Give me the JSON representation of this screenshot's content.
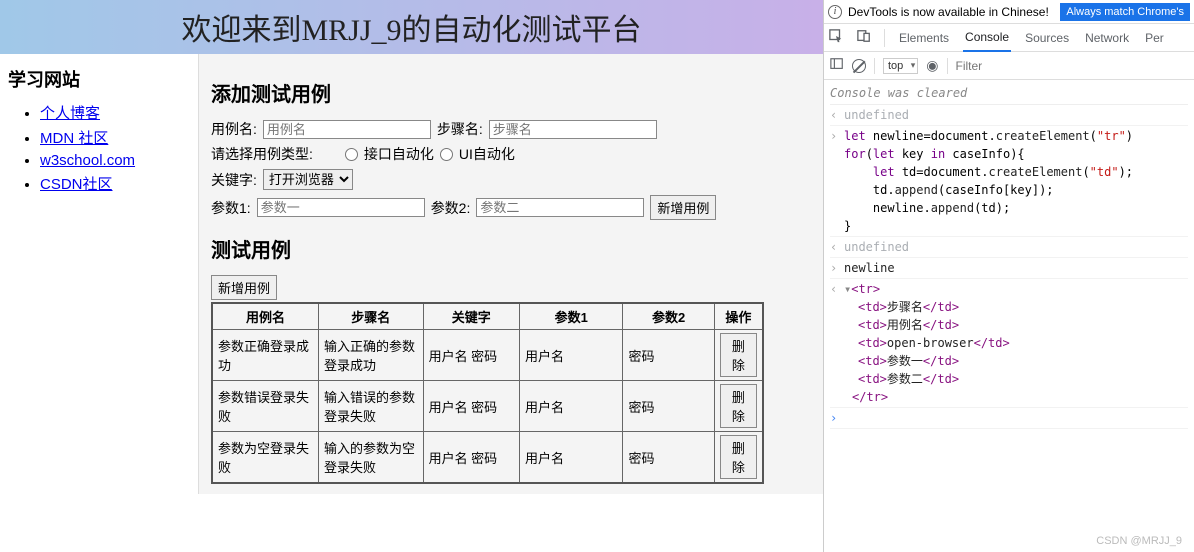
{
  "header": {
    "title": "欢迎来到MRJJ_9的自动化测试平台"
  },
  "sidebar": {
    "heading": "学习网站",
    "links": [
      {
        "label": "个人博客"
      },
      {
        "label": "MDN 社区"
      },
      {
        "label": "w3school.com"
      },
      {
        "label": "CSDN社区"
      }
    ]
  },
  "form": {
    "section_title": "添加测试用例",
    "case_label": "用例名:",
    "case_placeholder": "用例名",
    "step_label": "步骤名:",
    "step_placeholder": "步骤名",
    "type_label": "请选择用例类型:",
    "type_options": [
      "接口自动化",
      "UI自动化"
    ],
    "keyword_label": "关键字:",
    "keyword_selected": "打开浏览器",
    "param1_label": "参数1:",
    "param1_placeholder": "参数一",
    "param2_label": "参数2:",
    "param2_placeholder": "参数二",
    "add_btn": "新增用例"
  },
  "table": {
    "section_title": "测试用例",
    "add_btn": "新增用例",
    "headers": [
      "用例名",
      "步骤名",
      "关键字",
      "参数1",
      "参数2",
      "操作"
    ],
    "delete_label": "删除",
    "rows": [
      {
        "name": "参数正确登录成功",
        "step": "输入正确的参数登录成功",
        "kw": "用户名 密码",
        "p1": "用户名",
        "p2": "密码"
      },
      {
        "name": "参数错误登录失败",
        "step": "输入错误的参数登录失败",
        "kw": "用户名 密码",
        "p1": "用户名",
        "p2": "密码"
      },
      {
        "name": "参数为空登录失败",
        "step": "输入的参数为空登录失败",
        "kw": "用户名 密码",
        "p1": "用户名",
        "p2": "密码"
      }
    ]
  },
  "devtools": {
    "banner_text": "DevTools is now available in Chinese!",
    "banner_btn": "Always match Chrome's",
    "tabs": [
      "Elements",
      "Console",
      "Sources",
      "Network",
      "Per"
    ],
    "active_tab": "Console",
    "context": "top",
    "filter_placeholder": "Filter",
    "cleared_msg": "Console was cleared",
    "undefined_label": "undefined",
    "code_input": "let newline=document.createElement(\"tr\")\nfor(let key in caseInfo){\n    let td=document.createElement(\"td\");\n    td.append(caseInfo[key]);\n    newline.append(td);\n}",
    "newline_label": "newline",
    "tr_children": [
      "步骤名",
      "用例名",
      "open-browser",
      "参数一",
      "参数二"
    ]
  },
  "watermark": "CSDN @MRJJ_9"
}
